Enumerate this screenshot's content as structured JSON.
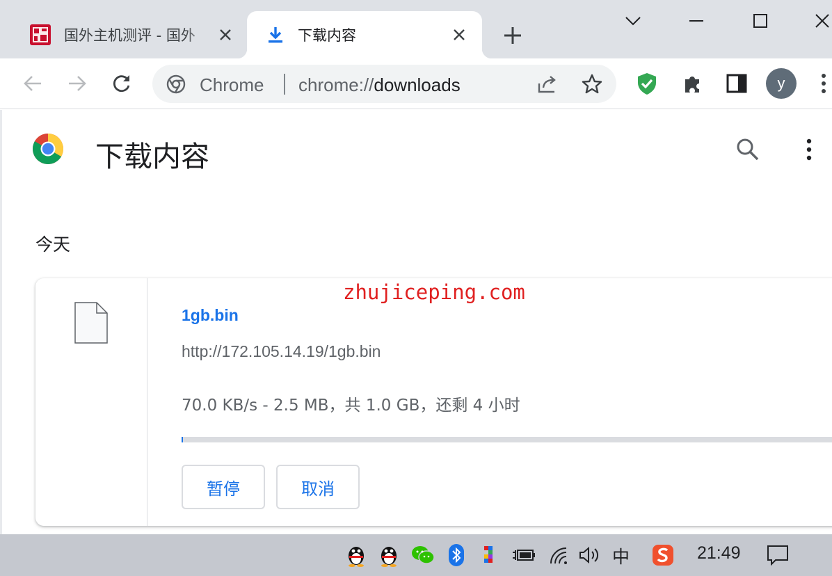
{
  "tabs": [
    {
      "title": "国外主机测评 - 国外",
      "active": false,
      "favicon": "site-logo-red"
    },
    {
      "title": "下载内容",
      "active": true,
      "favicon": "download-icon"
    }
  ],
  "omnibox": {
    "label": "Chrome",
    "url_scheme": "chrome://",
    "url_host": "downloads"
  },
  "profile": {
    "initial": "y"
  },
  "page": {
    "title": "下载内容",
    "section_date": "今天",
    "downloads": [
      {
        "file_name": "1gb.bin",
        "url": "http://172.105.14.19/1gb.bin",
        "status": "70.0 KB/s - 2.5 MB，共 1.0 GB，还剩 4 小时",
        "progress_fraction": 0.0025,
        "pause_label": "暂停",
        "cancel_label": "取消"
      }
    ]
  },
  "watermark": "zhujiceping.com",
  "taskbar": {
    "time": "21:49",
    "ime": "中"
  },
  "colors": {
    "accent": "#1a73e8",
    "tabstrip": "#dee1e6",
    "watermark": "#e02020",
    "taskbar": "#c5c8cf"
  }
}
